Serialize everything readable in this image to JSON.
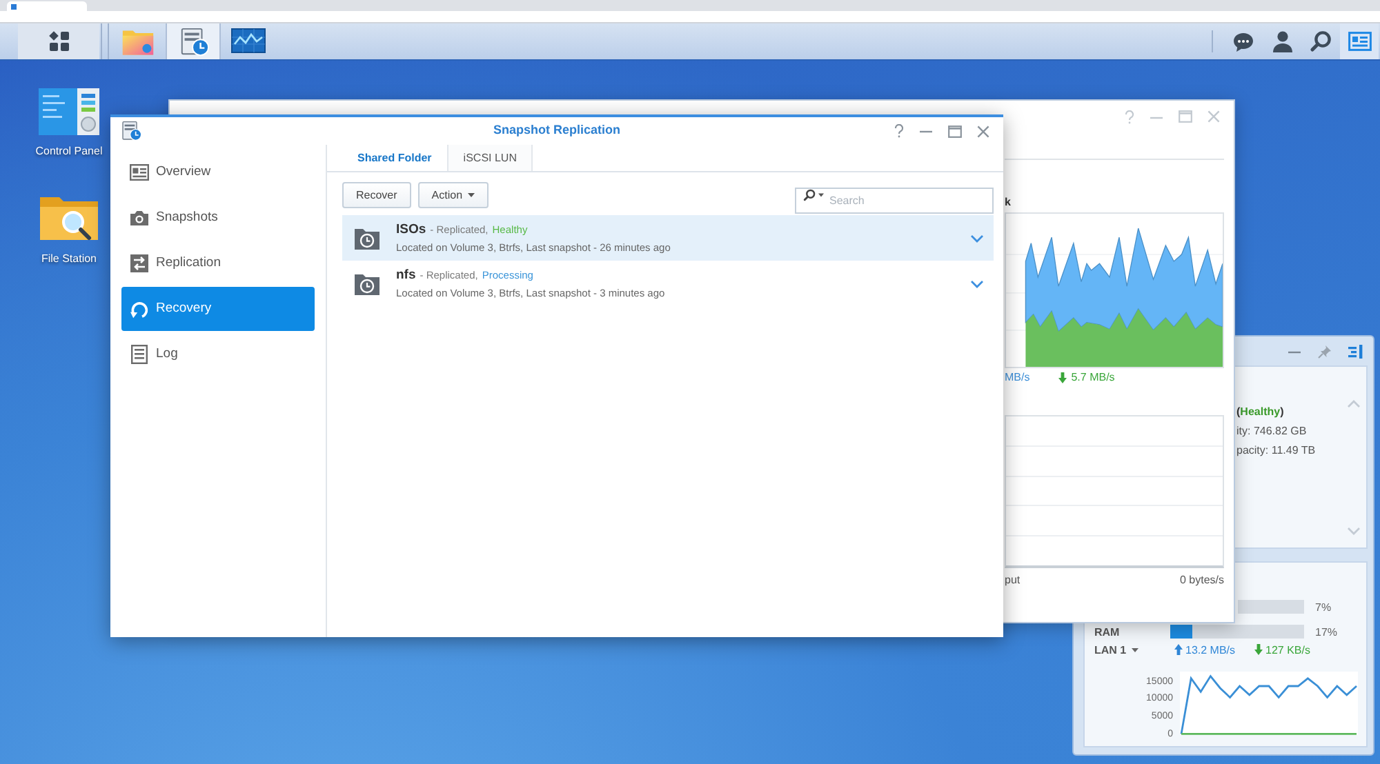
{
  "taskbar": {
    "apps": [
      {
        "kind": "menu",
        "selected": false
      },
      {
        "kind": "folder",
        "selected": false
      },
      {
        "kind": "snapshot",
        "selected": true
      },
      {
        "kind": "monitor",
        "selected": false
      }
    ],
    "tray": [
      {
        "kind": "chat",
        "selected": false
      },
      {
        "kind": "user",
        "selected": false
      },
      {
        "kind": "search",
        "selected": false
      },
      {
        "kind": "widgets",
        "selected": true
      }
    ]
  },
  "desktop_icons": [
    {
      "kind": "panel",
      "label": "Control Panel"
    },
    {
      "kind": "folder",
      "label": "File Station"
    }
  ],
  "main_window": {
    "title": "Snapshot Replication",
    "sidebar": [
      {
        "kind": "overview",
        "label": "Overview",
        "selected": false
      },
      {
        "kind": "camera",
        "label": "Snapshots",
        "selected": false
      },
      {
        "kind": "replication",
        "label": "Replication",
        "selected": false
      },
      {
        "kind": "recovery",
        "label": "Recovery",
        "selected": true
      },
      {
        "kind": "log",
        "label": "Log",
        "selected": false
      }
    ],
    "tabs": [
      {
        "label": "Shared Folder",
        "selected": true
      },
      {
        "label": "iSCSI LUN",
        "selected": false
      }
    ],
    "buttons": [
      {
        "kind": "plain",
        "label": "Recover"
      },
      {
        "kind": "menu",
        "label": "Action"
      }
    ],
    "search": {
      "placeholder": "Search"
    },
    "rows": [
      {
        "name": "ISOs",
        "detail": "- Replicated,",
        "status": {
          "text": "Healthy",
          "color": "#58b947"
        },
        "location": "Located on Volume 3, Btrfs, Last snapshot - 26 minutes ago",
        "selected": true
      },
      {
        "name": "nfs",
        "detail": "- Replicated,",
        "status": {
          "text": "Processing",
          "color": "#3b95d9"
        },
        "location": "Located on Volume 3, Btrfs, Last snapshot - 3 minutes ago",
        "selected": false
      }
    ]
  },
  "resource_window": {
    "section_title": "k",
    "upload_reading": "MB/s",
    "download_reading": "5.7 MB/s",
    "footer_left": "put",
    "footer_right": "0 bytes/s"
  },
  "widget": {
    "storage": {
      "status": "(**Healthy**)",
      "lines": [
        "ity: 746.82 GB",
        "pacity: 11.49 TB"
      ]
    },
    "resources": [
      {
        "reading": "7%"
      },
      {
        "label": "RAM",
        "level": 0.17,
        "reading": "17%"
      }
    ],
    "lan": {
      "label": "LAN 1",
      "upload": "13.2 MB/s",
      "download": "127 KB/s",
      "chart_data": {
        "type": "line",
        "yticks": [
          0,
          5000,
          10000,
          15000
        ],
        "ylim": [
          0,
          18000
        ],
        "series": [
          {
            "color": "#3a8fd6",
            "values": [
              0,
              16100,
              12300,
              16700,
              13300,
              10700,
              13900,
              11400,
              13900,
              13900,
              10700,
              13900,
              13900,
              16100,
              13900,
              10700,
              13900,
              11400,
              13900
            ]
          },
          {
            "color": "#5cb85c",
            "values": [
              200,
              200,
              200,
              200,
              200,
              200,
              200,
              200,
              200,
              200,
              200,
              200,
              200,
              200,
              200,
              200,
              200,
              200,
              200
            ]
          }
        ]
      }
    }
  }
}
